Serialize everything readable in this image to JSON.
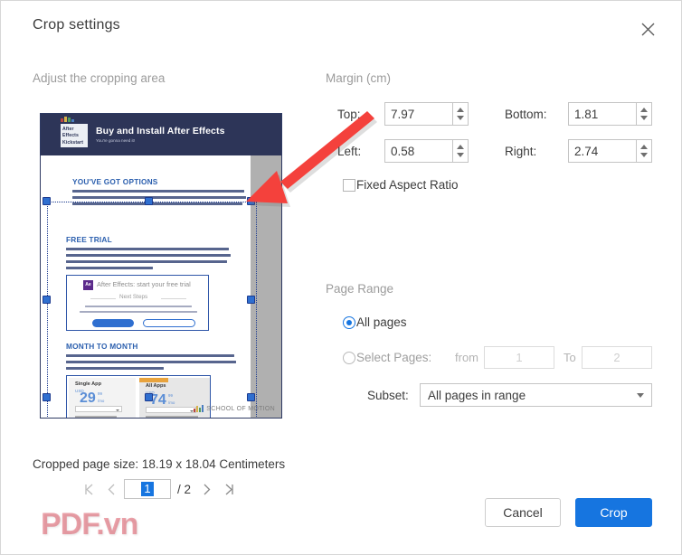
{
  "dialog": {
    "title": "Crop settings",
    "close_icon": "close-icon"
  },
  "sections": {
    "crop_area_caption": "Adjust the cropping area",
    "margin_caption": "Margin (cm)",
    "page_range_caption": "Page Range"
  },
  "margins": {
    "unit": "cm",
    "top": {
      "label": "Top:",
      "value": "7.97"
    },
    "bottom": {
      "label": "Bottom:",
      "value": "1.81"
    },
    "left": {
      "label": "Left:",
      "value": "0.58"
    },
    "right": {
      "label": "Right:",
      "value": "2.74"
    },
    "fixed_aspect_ratio": {
      "label": "Fixed Aspect Ratio",
      "checked": false
    }
  },
  "page_range": {
    "all_pages": {
      "label": "All pages",
      "selected": true
    },
    "select_pages": {
      "label": "Select Pages:",
      "selected": false
    },
    "from_label": "from",
    "from_value": "1",
    "to_label": "To",
    "to_value": "2",
    "subset_label": "Subset:",
    "subset_value": "All pages in range"
  },
  "footer": {
    "cropped_page_size": "Cropped page size: 18.19 x 18.04 Centimeters",
    "current_page": "1",
    "total_pages": "/ 2",
    "first_icon": "first-page-icon",
    "prev_icon": "prev-page-icon",
    "next_icon": "next-page-icon",
    "last_icon": "last-page-icon",
    "watermark": "PDF.vn",
    "cancel_label": "Cancel",
    "crop_label": "Crop"
  },
  "preview": {
    "header_title": "Buy and Install After Effects",
    "header_subtitle": "You're gonna need it!",
    "logo_line1": "After",
    "logo_line2": "Effects",
    "logo_line3": "Kickstart",
    "section1": "YOU'VE GOT OPTIONS",
    "section2": "FREE TRIAL",
    "section3": "MONTH TO MONTH",
    "trial_cta": "After Effects: start your free trial",
    "next_steps": "Next Steps",
    "price_card_1": {
      "name": "Single App",
      "usd": "USD",
      "amount": "29",
      "cents": "99",
      "per": "/mo"
    },
    "price_card_2": {
      "name": "All Apps",
      "usd": "USD",
      "amount": "74",
      "cents": "99",
      "per": "/mo"
    },
    "footer_brand": "SCHOOL OF MOTION"
  },
  "colors": {
    "accent": "#1675e0",
    "navy": "#2d3558",
    "arrow": "#f4413c",
    "watermark": "#de5060"
  }
}
